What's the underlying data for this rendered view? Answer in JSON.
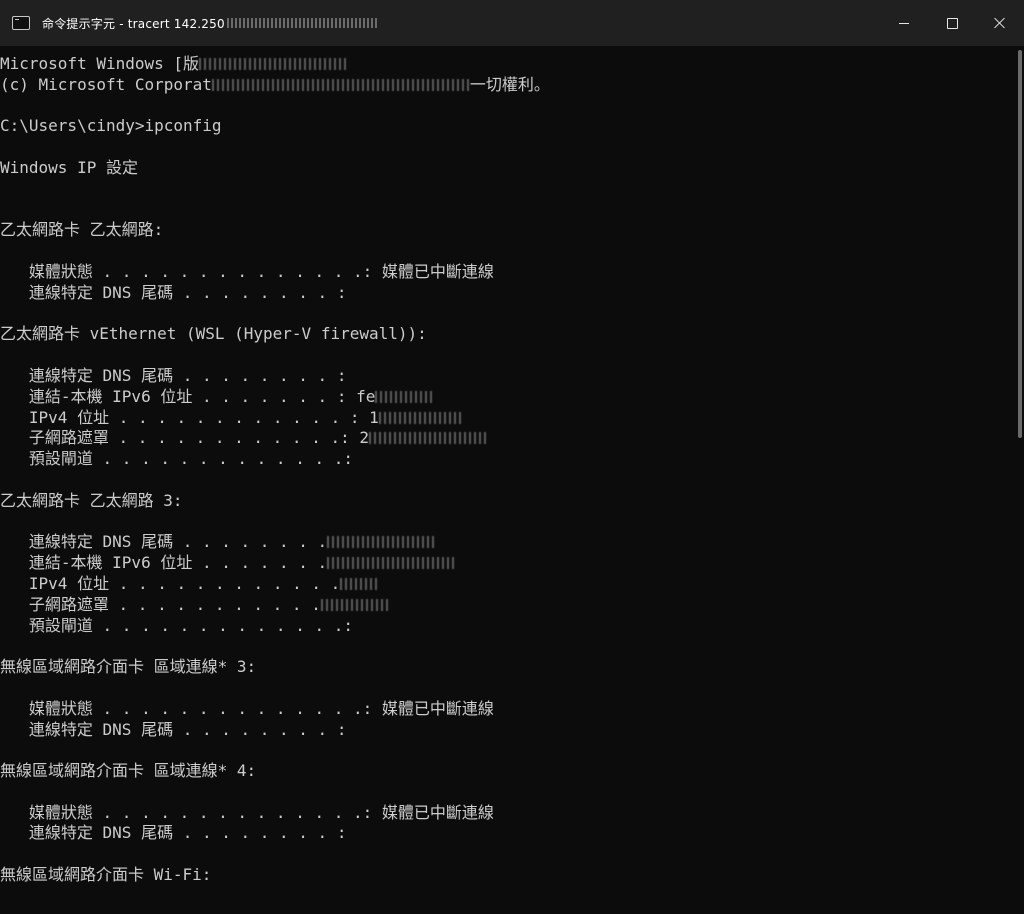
{
  "window": {
    "title": "命令提示字元 - tracert  142.250"
  },
  "console": {
    "lines": [
      "Microsoft Windows [版",
      "(c) Microsoft Corporat",
      "",
      "C:\\Users\\cindy>ipconfig",
      "",
      "Windows IP 設定",
      "",
      "",
      "乙太網路卡 乙太網路:",
      "",
      "   媒體狀態 . . . . . . . . . . . . . .: 媒體已中斷連線",
      "   連線特定 DNS 尾碼 . . . . . . . . :",
      "",
      "乙太網路卡 vEthernet (WSL (Hyper-V firewall)):",
      "",
      "   連線特定 DNS 尾碼 . . . . . . . . :",
      "   連結-本機 IPv6 位址 . . . . . . . : fe",
      "   IPv4 位址 . . . . . . . . . . . . : 1",
      "   子網路遮罩 . . . . . . . . . . . .: 2",
      "   預設閘道 . . . . . . . . . . . . .:",
      "",
      "乙太網路卡 乙太網路 3:",
      "",
      "   連線特定 DNS 尾碼 . . . . . . . .",
      "   連結-本機 IPv6 位址 . . . . . . .",
      "   IPv4 位址 . . . . . . . . . . . .",
      "   子網路遮罩 . . . . . . . . . . .",
      "   預設閘道 . . . . . . . . . . . . .:",
      "",
      "無線區域網路介面卡 區域連線* 3:",
      "",
      "   媒體狀態 . . . . . . . . . . . . . .: 媒體已中斷連線",
      "   連線特定 DNS 尾碼 . . . . . . . . :",
      "",
      "無線區域網路介面卡 區域連線* 4:",
      "",
      "   媒體狀態 . . . . . . . . . . . . . .: 媒體已中斷連線",
      "   連線特定 DNS 尾碼 . . . . . . . . :",
      "",
      "無線區域網路介面卡 Wi-Fi:"
    ],
    "copyright_tail": "一切權利。",
    "text_color": "#cccccc",
    "background_color": "#0c0c0c"
  },
  "icons": {
    "app": "terminal-icon",
    "minimize": "minimize-icon",
    "maximize": "maximize-icon",
    "close": "close-icon"
  }
}
